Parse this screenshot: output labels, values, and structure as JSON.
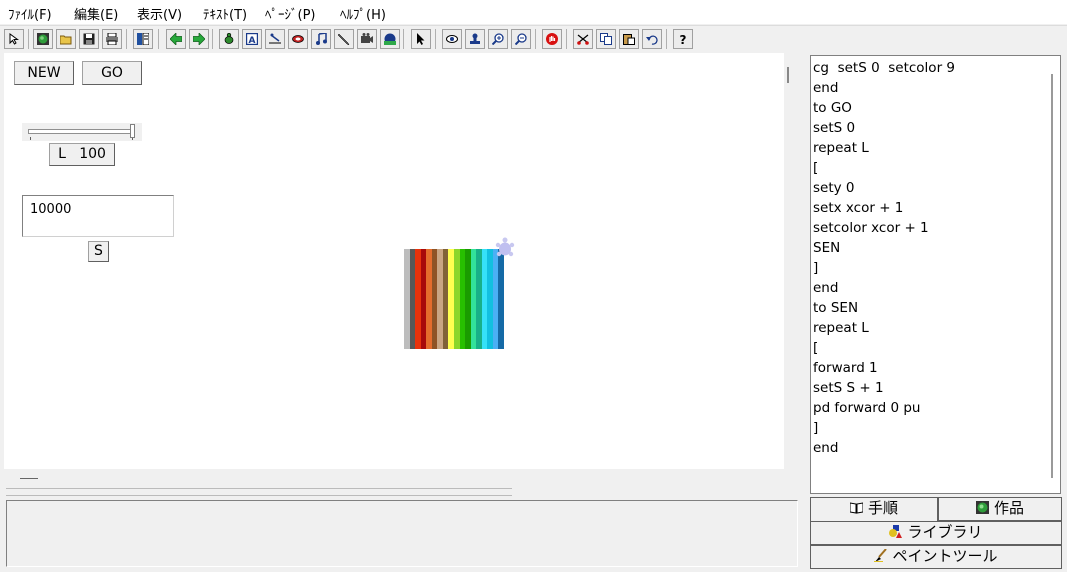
{
  "menu": [
    "ﾌｧｲﾙ(F)",
    "編集(E)",
    "表示(V)",
    "ﾃｷｽﾄ(T)",
    "ﾍﾟｰｼﾞ(P)",
    "ﾍﾙﾌﾟ(H)"
  ],
  "toolbar_icons": [
    "pointer-small-icon",
    "globe-icon",
    "open-folder-icon",
    "save-icon",
    "print-icon",
    "page-layout-icon",
    "back-arrow-icon",
    "forward-arrow-icon",
    "turtle-icon",
    "text-box-icon",
    "slider-tool-icon",
    "button-tool-icon",
    "music-icon",
    "pen-icon",
    "camera-icon",
    "sphere-icon",
    "select-arrow-icon",
    "eye-icon",
    "stamp-icon",
    "zoom-in-icon",
    "zoom-out-icon",
    "stop-hand-icon",
    "cut-icon",
    "copy-icon",
    "paste-icon",
    "undo-icon",
    "help-icon"
  ],
  "canvas": {
    "new_button": "NEW",
    "go_button": "GO",
    "slider_label": "L   100",
    "slider_value": 100,
    "text_box_value": "10000",
    "s_button": "S"
  },
  "rainbow_colors": [
    "#bdbdbd",
    "#585858",
    "#e8320c",
    "#a8090a",
    "#e46c2c",
    "#8f5325",
    "#c9a583",
    "#816238",
    "#ffff50",
    "#8cd62a",
    "#27c000",
    "#1a9c00",
    "#32e29a",
    "#18b088",
    "#35e1f8",
    "#12c0e0",
    "#4ab0f5",
    "#156aa6"
  ],
  "code_lines": [
    "cg  setS 0  setcolor 9",
    "end",
    "to GO",
    "setS 0",
    "repeat L",
    "[",
    "sety 0",
    "setx xcor + 1",
    "setcolor xcor + 1",
    "SEN",
    "]",
    "end",
    "to SEN",
    "repeat L",
    "[",
    "forward 1",
    "setS S + 1",
    "pd forward 0 pu",
    "]",
    "end"
  ],
  "tabs": {
    "procedures": "手順",
    "works": "作品",
    "library": "ライブラリ",
    "paint_tool": "ペイントツール"
  }
}
